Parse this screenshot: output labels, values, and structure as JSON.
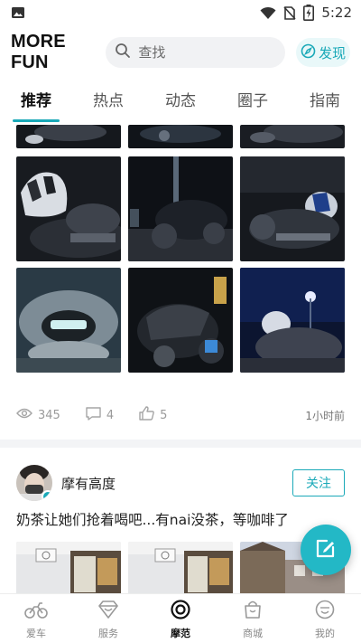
{
  "status_bar": {
    "time": "5:22",
    "icons": [
      "image-icon",
      "wifi-icon",
      "no-sim-icon",
      "battery-charging-icon"
    ]
  },
  "header": {
    "brand": "MORE FUN",
    "search_placeholder": "查找",
    "discover_label": "发现"
  },
  "tabs": [
    {
      "label": "推荐",
      "active": true
    },
    {
      "label": "热点"
    },
    {
      "label": "动态"
    },
    {
      "label": "圈子"
    },
    {
      "label": "指南"
    }
  ],
  "feed": {
    "first_post": {
      "stats": {
        "views": "345",
        "comments": "4",
        "likes": "5",
        "time": "1小时前"
      }
    },
    "second_post": {
      "username": "摩有高度",
      "follow_label": "关注",
      "text": "奶茶让她们抢着喝吧...有nai没茶，等咖啡了"
    }
  },
  "bottom_nav": [
    {
      "label": "爱车",
      "icon": "motorcycle-icon"
    },
    {
      "label": "服务",
      "icon": "diamond-icon"
    },
    {
      "label": "摩范",
      "icon": "target-icon",
      "active": true
    },
    {
      "label": "商城",
      "icon": "shopping-bag-icon"
    },
    {
      "label": "我的",
      "icon": "smiley-icon"
    }
  ],
  "colors": {
    "accent": "#1aa9b8",
    "fab": "#23b8c6"
  }
}
